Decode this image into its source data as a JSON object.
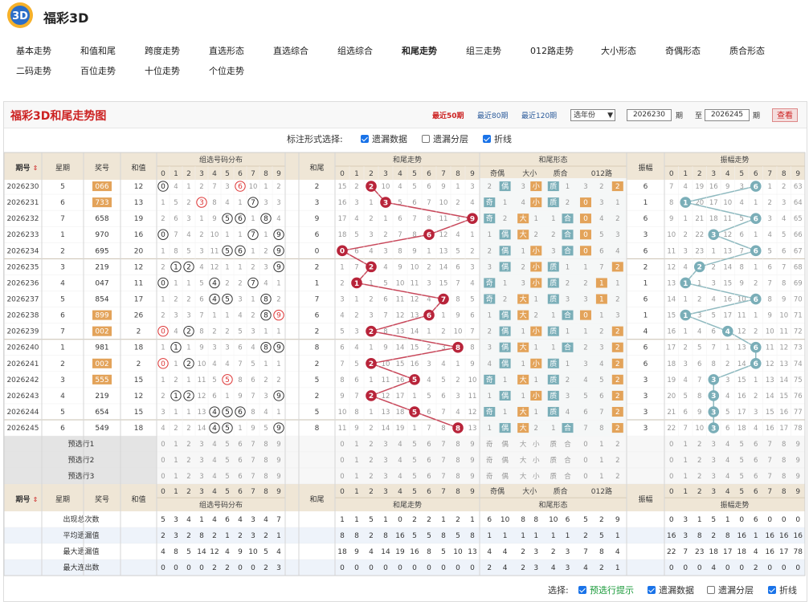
{
  "app": {
    "title": "福彩3D"
  },
  "nav": [
    [
      "基本走势",
      "和值和尾",
      "跨度走势",
      "直选形态",
      "直选综合",
      "组选综合",
      "和尾走势",
      "组三走势",
      "012路走势",
      "大小形态",
      "奇偶形态",
      "质合形态"
    ],
    [
      "二码走势",
      "百位走势",
      "十位走势",
      "个位走势"
    ]
  ],
  "active_nav": "和尾走势",
  "panel": {
    "title": "福彩3D和尾走势图",
    "recent": [
      "最近50期",
      "最近80期",
      "最近120期"
    ],
    "year_select": "选年份",
    "from_period": "2026230",
    "to_period": "2026245",
    "period_label": "期",
    "to_label": "至",
    "query_label": "查看"
  },
  "mark_opts": {
    "label": "标注形式选择:",
    "items": [
      {
        "label": "遗漏数据",
        "on": true
      },
      {
        "label": "遗漏分层",
        "on": false
      },
      {
        "label": "折线",
        "on": true
      }
    ]
  },
  "headers": {
    "period": "期号",
    "weekday": "星期",
    "award": "奖号",
    "sum": "和值",
    "zuxuan": "组选号码分布",
    "tail": "和尾",
    "tail_trend": "和尾走势",
    "tail_shape": "和尾形态",
    "odd_even": "奇偶",
    "big_small": "大小",
    "prime": "质合",
    "route": "012路",
    "amp": "振幅",
    "amp_trend": "振幅走势",
    "digits": [
      "0",
      "1",
      "2",
      "3",
      "4",
      "5",
      "6",
      "7",
      "8",
      "9"
    ],
    "shape_small": [
      "奇",
      "偶",
      "大",
      "小",
      "质",
      "合",
      "0",
      "1",
      "2"
    ]
  },
  "rows": [
    {
      "period": "2026230",
      "week": "5",
      "award": "066",
      "zu3": true,
      "sum": "12",
      "zx": [
        "0",
        "4",
        "1",
        "2",
        "7",
        "3",
        "6",
        "10",
        "1",
        "2"
      ],
      "tail": "2",
      "tt": [
        "15",
        "2",
        "2",
        "10",
        "4",
        "5",
        "6",
        "9",
        "1",
        "3"
      ],
      "oe": [
        "2",
        "偶"
      ],
      "bs": [
        "3",
        "小"
      ],
      "pc": [
        "质",
        "1"
      ],
      "rt": [
        "3",
        "2",
        "2"
      ],
      "amp": "6",
      "at": [
        "7",
        "4",
        "19",
        "16",
        "9",
        "3",
        "6",
        "1",
        "2",
        "63"
      ]
    },
    {
      "period": "2026231",
      "week": "6",
      "award": "733",
      "zu3": true,
      "sum": "13",
      "zx": [
        "1",
        "5",
        "2",
        "3",
        "8",
        "4",
        "1",
        "7",
        "3",
        "3"
      ],
      "tail": "3",
      "tt": [
        "16",
        "3",
        "1",
        "3",
        "5",
        "6",
        "7",
        "10",
        "2",
        "4"
      ],
      "oe": [
        "奇",
        "1"
      ],
      "bs": [
        "4",
        "小"
      ],
      "pc": [
        "质",
        "2"
      ],
      "rt": [
        "0",
        "3",
        "1"
      ],
      "amp": "1",
      "at": [
        "8",
        "1",
        "20",
        "17",
        "10",
        "4",
        "1",
        "2",
        "3",
        "64"
      ]
    },
    {
      "period": "2026232",
      "week": "7",
      "award": "658",
      "zu3": false,
      "sum": "19",
      "zx": [
        "2",
        "6",
        "3",
        "1",
        "9",
        "5",
        "6",
        "1",
        "8",
        "4"
      ],
      "tail": "9",
      "tt": [
        "17",
        "4",
        "2",
        "1",
        "6",
        "7",
        "8",
        "11",
        "3",
        "9"
      ],
      "oe": [
        "奇",
        "2"
      ],
      "bs": [
        "大",
        "1"
      ],
      "pc": [
        "1",
        "合"
      ],
      "rt": [
        "0",
        "4",
        "2"
      ],
      "amp": "6",
      "at": [
        "9",
        "1",
        "21",
        "18",
        "11",
        "5",
        "6",
        "3",
        "4",
        "65"
      ]
    },
    {
      "period": "2026233",
      "week": "1",
      "award": "970",
      "zu3": false,
      "sum": "16",
      "zx": [
        "0",
        "7",
        "4",
        "2",
        "10",
        "1",
        "1",
        "7",
        "1",
        "9"
      ],
      "tail": "6",
      "tt": [
        "18",
        "5",
        "3",
        "2",
        "7",
        "8",
        "6",
        "12",
        "4",
        "1"
      ],
      "oe": [
        "1",
        "偶"
      ],
      "bs": [
        "大",
        "2"
      ],
      "pc": [
        "2",
        "合"
      ],
      "rt": [
        "0",
        "5",
        "3"
      ],
      "amp": "3",
      "at": [
        "10",
        "2",
        "22",
        "3",
        "12",
        "6",
        "1",
        "4",
        "5",
        "66"
      ]
    },
    {
      "period": "2026234",
      "week": "2",
      "award": "695",
      "zu3": false,
      "sum": "20",
      "zx": [
        "1",
        "8",
        "5",
        "3",
        "11",
        "5",
        "6",
        "1",
        "2",
        "9"
      ],
      "tail": "0",
      "tt": [
        "0",
        "6",
        "4",
        "3",
        "8",
        "9",
        "1",
        "13",
        "5",
        "2"
      ],
      "oe": [
        "2",
        "偶"
      ],
      "bs": [
        "1",
        "小"
      ],
      "pc": [
        "3",
        "合"
      ],
      "rt": [
        "0",
        "6",
        "4"
      ],
      "amp": "6",
      "at": [
        "11",
        "3",
        "23",
        "1",
        "13",
        "7",
        "6",
        "5",
        "6",
        "67"
      ]
    },
    {
      "period": "2026235",
      "week": "3",
      "award": "219",
      "zu3": false,
      "sum": "12",
      "zx": [
        "2",
        "1",
        "2",
        "4",
        "12",
        "1",
        "1",
        "2",
        "3",
        "9"
      ],
      "tail": "2",
      "tt": [
        "1",
        "7",
        "2",
        "4",
        "9",
        "10",
        "2",
        "14",
        "6",
        "3"
      ],
      "oe": [
        "3",
        "偶"
      ],
      "bs": [
        "2",
        "小"
      ],
      "pc": [
        "质",
        "1"
      ],
      "rt": [
        "1",
        "7",
        "2"
      ],
      "amp": "2",
      "at": [
        "12",
        "4",
        "2",
        "2",
        "14",
        "8",
        "1",
        "6",
        "7",
        "68"
      ]
    },
    {
      "period": "2026236",
      "week": "4",
      "award": "047",
      "zu3": false,
      "sum": "11",
      "zx": [
        "0",
        "1",
        "1",
        "5",
        "4",
        "2",
        "2",
        "7",
        "4",
        "1"
      ],
      "tail": "1",
      "tt": [
        "2",
        "1",
        "1",
        "5",
        "10",
        "11",
        "3",
        "15",
        "7",
        "4"
      ],
      "oe": [
        "奇",
        "1"
      ],
      "bs": [
        "3",
        "小"
      ],
      "pc": [
        "质",
        "2"
      ],
      "rt": [
        "2",
        "1",
        "1"
      ],
      "amp": "1",
      "at": [
        "13",
        "1",
        "1",
        "3",
        "15",
        "9",
        "2",
        "7",
        "8",
        "69"
      ]
    },
    {
      "period": "2026237",
      "week": "5",
      "award": "854",
      "zu3": false,
      "sum": "17",
      "zx": [
        "1",
        "2",
        "2",
        "6",
        "4",
        "5",
        "3",
        "1",
        "8",
        "2"
      ],
      "tail": "7",
      "tt": [
        "3",
        "1",
        "2",
        "6",
        "11",
        "12",
        "4",
        "7",
        "8",
        "5"
      ],
      "oe": [
        "奇",
        "2"
      ],
      "bs": [
        "大",
        "1"
      ],
      "pc": [
        "质",
        "3"
      ],
      "rt": [
        "3",
        "1",
        "2"
      ],
      "amp": "6",
      "at": [
        "14",
        "1",
        "2",
        "4",
        "16",
        "10",
        "6",
        "8",
        "9",
        "70"
      ]
    },
    {
      "period": "2026238",
      "week": "6",
      "award": "899",
      "zu3": true,
      "sum": "26",
      "zx": [
        "2",
        "3",
        "3",
        "7",
        "1",
        "1",
        "4",
        "2",
        "8",
        "9"
      ],
      "tail": "6",
      "tt": [
        "4",
        "2",
        "3",
        "7",
        "12",
        "13",
        "6",
        "1",
        "9",
        "6"
      ],
      "oe": [
        "1",
        "偶"
      ],
      "bs": [
        "大",
        "2"
      ],
      "pc": [
        "1",
        "合"
      ],
      "rt": [
        "0",
        "1",
        "3"
      ],
      "amp": "1",
      "at": [
        "15",
        "1",
        "3",
        "5",
        "17",
        "11",
        "1",
        "9",
        "10",
        "71"
      ]
    },
    {
      "period": "2026239",
      "week": "7",
      "award": "002",
      "zu3": true,
      "sum": "2",
      "zx": [
        "0",
        "4",
        "2",
        "8",
        "2",
        "2",
        "5",
        "3",
        "1",
        "1"
      ],
      "tail": "2",
      "tt": [
        "5",
        "3",
        "2",
        "8",
        "13",
        "14",
        "1",
        "2",
        "10",
        "7"
      ],
      "oe": [
        "2",
        "偶"
      ],
      "bs": [
        "1",
        "小"
      ],
      "pc": [
        "质",
        "1"
      ],
      "rt": [
        "1",
        "2",
        "2"
      ],
      "amp": "4",
      "at": [
        "16",
        "1",
        "4",
        "6",
        "4",
        "12",
        "2",
        "10",
        "11",
        "72"
      ]
    },
    {
      "period": "2026240",
      "week": "1",
      "award": "981",
      "zu3": false,
      "sum": "18",
      "zx": [
        "1",
        "1",
        "1",
        "9",
        "3",
        "3",
        "6",
        "4",
        "8",
        "9"
      ],
      "tail": "8",
      "tt": [
        "6",
        "4",
        "1",
        "9",
        "14",
        "15",
        "2",
        "3",
        "8",
        "8"
      ],
      "oe": [
        "3",
        "偶"
      ],
      "bs": [
        "大",
        "1"
      ],
      "pc": [
        "1",
        "合"
      ],
      "rt": [
        "2",
        "3",
        "2"
      ],
      "amp": "6",
      "at": [
        "17",
        "2",
        "5",
        "7",
        "1",
        "13",
        "6",
        "11",
        "12",
        "73"
      ]
    },
    {
      "period": "2026241",
      "week": "2",
      "award": "002",
      "zu3": true,
      "sum": "2",
      "zx": [
        "0",
        "1",
        "2",
        "10",
        "4",
        "4",
        "7",
        "5",
        "1",
        "1"
      ],
      "tail": "2",
      "tt": [
        "7",
        "5",
        "2",
        "10",
        "15",
        "16",
        "3",
        "4",
        "1",
        "9"
      ],
      "oe": [
        "4",
        "偶"
      ],
      "bs": [
        "1",
        "小"
      ],
      "pc": [
        "质",
        "1"
      ],
      "rt": [
        "3",
        "4",
        "2"
      ],
      "amp": "6",
      "at": [
        "18",
        "3",
        "6",
        "8",
        "2",
        "14",
        "6",
        "12",
        "13",
        "74"
      ]
    },
    {
      "period": "2026242",
      "week": "3",
      "award": "555",
      "zu3": true,
      "sum": "15",
      "zx": [
        "1",
        "2",
        "1",
        "11",
        "5",
        "5",
        "8",
        "6",
        "2",
        "2"
      ],
      "tail": "5",
      "tt": [
        "8",
        "6",
        "1",
        "11",
        "16",
        "5",
        "4",
        "5",
        "2",
        "10"
      ],
      "oe": [
        "奇",
        "1"
      ],
      "bs": [
        "大",
        "1"
      ],
      "pc": [
        "质",
        "2"
      ],
      "rt": [
        "4",
        "5",
        "2"
      ],
      "amp": "3",
      "at": [
        "19",
        "4",
        "7",
        "3",
        "3",
        "15",
        "1",
        "13",
        "14",
        "75"
      ]
    },
    {
      "period": "2026243",
      "week": "4",
      "award": "219",
      "zu3": false,
      "sum": "12",
      "zx": [
        "2",
        "1",
        "2",
        "12",
        "6",
        "1",
        "9",
        "7",
        "3",
        "9"
      ],
      "tail": "2",
      "tt": [
        "9",
        "7",
        "2",
        "12",
        "17",
        "1",
        "5",
        "6",
        "3",
        "11"
      ],
      "oe": [
        "1",
        "偶"
      ],
      "bs": [
        "1",
        "小"
      ],
      "pc": [
        "质",
        "3"
      ],
      "rt": [
        "5",
        "6",
        "2"
      ],
      "amp": "3",
      "at": [
        "20",
        "5",
        "8",
        "3",
        "4",
        "16",
        "2",
        "14",
        "15",
        "76"
      ]
    },
    {
      "period": "2026244",
      "week": "5",
      "award": "654",
      "zu3": false,
      "sum": "15",
      "zx": [
        "3",
        "1",
        "1",
        "13",
        "4",
        "5",
        "6",
        "8",
        "4",
        "1"
      ],
      "tail": "5",
      "tt": [
        "10",
        "8",
        "1",
        "13",
        "18",
        "5",
        "6",
        "7",
        "4",
        "12"
      ],
      "oe": [
        "奇",
        "1"
      ],
      "bs": [
        "大",
        "1"
      ],
      "pc": [
        "质",
        "4"
      ],
      "rt": [
        "6",
        "7",
        "2"
      ],
      "amp": "3",
      "at": [
        "21",
        "6",
        "9",
        "3",
        "5",
        "17",
        "3",
        "15",
        "16",
        "77"
      ]
    },
    {
      "period": "2026245",
      "week": "6",
      "award": "549",
      "zu3": false,
      "sum": "18",
      "zx": [
        "4",
        "2",
        "2",
        "14",
        "4",
        "5",
        "1",
        "9",
        "5",
        "9"
      ],
      "tail": "8",
      "tt": [
        "11",
        "9",
        "2",
        "14",
        "19",
        "1",
        "7",
        "8",
        "8",
        "13"
      ],
      "oe": [
        "1",
        "偶"
      ],
      "bs": [
        "大",
        "2"
      ],
      "pc": [
        "1",
        "合"
      ],
      "rt": [
        "7",
        "8",
        "2"
      ],
      "amp": "3",
      "at": [
        "22",
        "7",
        "10",
        "3",
        "6",
        "18",
        "4",
        "16",
        "17",
        "78"
      ]
    }
  ],
  "predict_rows": [
    "预选行1",
    "预选行2",
    "预选行3"
  ],
  "stats": [
    {
      "label": "出现总次数",
      "zx": [
        "5",
        "3",
        "4",
        "1",
        "4",
        "6",
        "4",
        "3",
        "4",
        "7"
      ],
      "tt": [
        "1",
        "1",
        "5",
        "1",
        "0",
        "2",
        "2",
        "1",
        "2",
        "1"
      ],
      "sh": [
        "6",
        "10",
        "8",
        "8",
        "10",
        "6",
        "5",
        "2",
        "9"
      ],
      "amp": "",
      "at": [
        "0",
        "3",
        "1",
        "5",
        "1",
        "0",
        "6",
        "0",
        "0",
        "0"
      ]
    },
    {
      "label": "平均遗漏值",
      "zx": [
        "2",
        "3",
        "2",
        "8",
        "2",
        "1",
        "2",
        "3",
        "2",
        "1"
      ],
      "tt": [
        "8",
        "8",
        "2",
        "8",
        "16",
        "5",
        "5",
        "8",
        "5",
        "8"
      ],
      "sh": [
        "1",
        "1",
        "1",
        "1",
        "1",
        "1",
        "2",
        "5",
        "1"
      ],
      "amp": "",
      "at": [
        "16",
        "3",
        "8",
        "2",
        "8",
        "16",
        "1",
        "16",
        "16",
        "16"
      ]
    },
    {
      "label": "最大遗漏值",
      "zx": [
        "4",
        "8",
        "5",
        "14",
        "12",
        "4",
        "9",
        "10",
        "5",
        "4"
      ],
      "tt": [
        "18",
        "9",
        "4",
        "14",
        "19",
        "16",
        "8",
        "5",
        "10",
        "13"
      ],
      "sh": [
        "4",
        "4",
        "2",
        "3",
        "2",
        "3",
        "7",
        "8",
        "4"
      ],
      "amp": "",
      "at": [
        "22",
        "7",
        "23",
        "18",
        "17",
        "18",
        "4",
        "16",
        "17",
        "78"
      ]
    },
    {
      "label": "最大连出数",
      "zx": [
        "0",
        "0",
        "0",
        "0",
        "2",
        "2",
        "0",
        "0",
        "2",
        "3"
      ],
      "tt": [
        "0",
        "0",
        "0",
        "0",
        "0",
        "0",
        "0",
        "0",
        "0",
        "0"
      ],
      "sh": [
        "2",
        "4",
        "2",
        "3",
        "4",
        "3",
        "4",
        "2",
        "1"
      ],
      "amp": "",
      "at": [
        "0",
        "0",
        "0",
        "4",
        "0",
        "0",
        "2",
        "0",
        "0",
        "0"
      ]
    }
  ],
  "bottom_opts": {
    "label": "选择:",
    "items": [
      {
        "label": "预选行提示",
        "on": true,
        "green": true
      },
      {
        "label": "遗漏数据",
        "on": true
      },
      {
        "label": "遗漏分层",
        "on": false
      },
      {
        "label": "折线",
        "on": true
      }
    ]
  },
  "colors": {
    "accent": "#c22a2a",
    "hit_red": "#b8243a",
    "hit_teal": "#7aaeb8",
    "orange": "#e3a35a",
    "zu3": "#e3a35a"
  }
}
